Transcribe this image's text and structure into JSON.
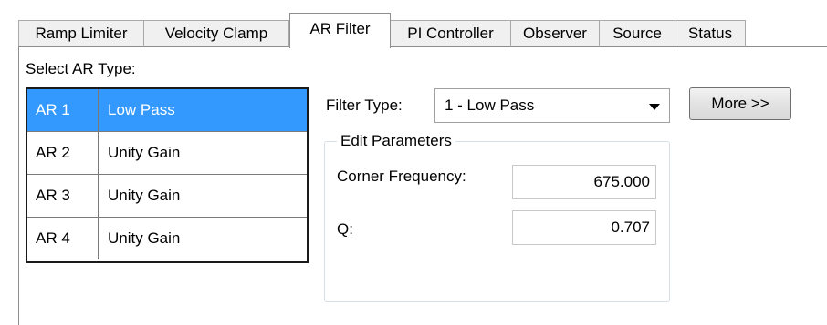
{
  "tabs": [
    {
      "label": "Ramp Limiter",
      "active": false
    },
    {
      "label": "Velocity Clamp",
      "active": false
    },
    {
      "label": "AR Filter",
      "active": true
    },
    {
      "label": "PI Controller",
      "active": false
    },
    {
      "label": "Observer",
      "active": false
    },
    {
      "label": "Source",
      "active": false
    },
    {
      "label": "Status",
      "active": false
    }
  ],
  "ar_section": {
    "label": "Select AR Type:",
    "rows": [
      {
        "id": "AR 1",
        "type": "Low Pass",
        "selected": true
      },
      {
        "id": "AR 2",
        "type": "Unity Gain",
        "selected": false
      },
      {
        "id": "AR 3",
        "type": "Unity Gain",
        "selected": false
      },
      {
        "id": "AR 4",
        "type": "Unity Gain",
        "selected": false
      }
    ]
  },
  "filter": {
    "label": "Filter Type:",
    "selected": "1 - Low Pass"
  },
  "more_button": "More >>",
  "params": {
    "title": "Edit Parameters",
    "corner_label": "Corner Frequency:",
    "corner_value": "675.000",
    "q_label": "Q:",
    "q_value": "0.707"
  },
  "colors": {
    "selection": "#3399ff",
    "selection_text": "#ffffff"
  }
}
